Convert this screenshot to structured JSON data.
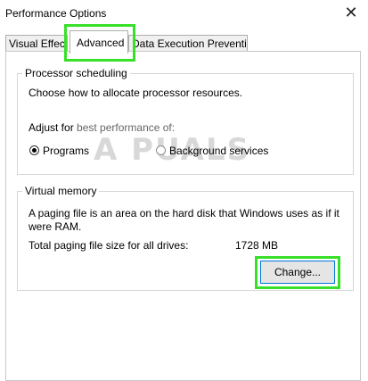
{
  "window": {
    "title": "Performance Options",
    "close_glyph": "✕"
  },
  "tabs": [
    {
      "label": "Visual Effects"
    },
    {
      "label": "Advanced"
    },
    {
      "label": "Data Execution Prevention"
    }
  ],
  "processor": {
    "legend": "Processor scheduling",
    "description": "Choose how to allocate processor resources.",
    "adjust_prefix": "Adjust for ",
    "adjust_suffix": "best performance of:",
    "options": [
      {
        "label": "Programs",
        "selected": true
      },
      {
        "label": "Background services",
        "selected": false
      }
    ]
  },
  "virtual_memory": {
    "legend": "Virtual memory",
    "description_line1": "A paging file is an area on the hard disk that Windows uses as if it",
    "description_line2": "were RAM.",
    "total_label": "Total paging file size for all drives:",
    "total_value": "1728 MB",
    "change_button": "Change..."
  },
  "highlight_color": "#39e029",
  "watermark": "A   PUALS"
}
